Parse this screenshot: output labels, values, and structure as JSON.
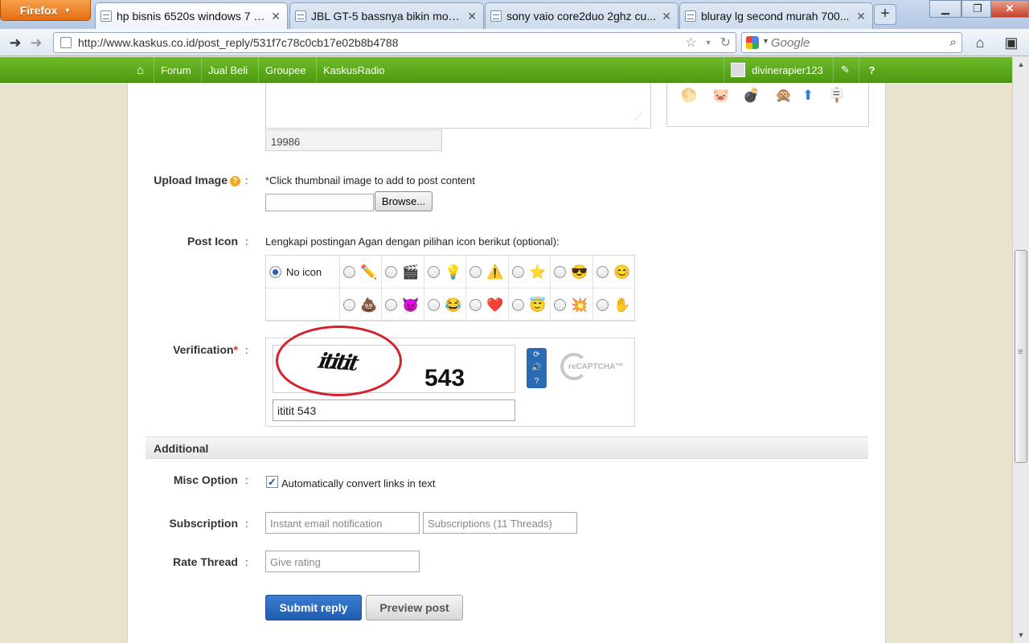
{
  "browser": {
    "menu_label": "Firefox",
    "tabs": [
      {
        "title": "hp bisnis 6520s windows 7 c...",
        "active": true
      },
      {
        "title": "JBL GT-5 bassnya bikin mob...",
        "active": false
      },
      {
        "title": "sony vaio core2duo 2ghz cu...",
        "active": false
      },
      {
        "title": "bluray lg second murah 700...",
        "active": false
      }
    ],
    "new_tab": "+",
    "url": "http://www.kaskus.co.id/post_reply/531f7c78c0cb17e02b8b4788",
    "search_placeholder": "Google"
  },
  "kaskus_nav": {
    "items": [
      "Forum",
      "Jual Beli",
      "Groupee",
      "KaskusRadio"
    ],
    "username": "divinerapier123"
  },
  "form": {
    "char_count": "19986",
    "upload_image": {
      "label": "Upload Image",
      "hint": "*Click thumbnail image to add to post content",
      "browse_label": "Browse..."
    },
    "post_icon": {
      "label": "Post Icon",
      "hint": "Lengkapi postingan Agan dengan pilihan icon berikut (optional):",
      "no_icon_label": "No icon",
      "row1": [
        "✏️",
        "🎬",
        "💡",
        "⚠️",
        "⭐",
        "😎",
        "😊"
      ],
      "row2": [
        "💩",
        "😈",
        "😂",
        "❤️",
        "😇",
        "💥",
        "✋"
      ]
    },
    "verification": {
      "label": "Verification",
      "required_mark": "*",
      "captcha_word1": "ititit",
      "captcha_word2": "543",
      "recaptcha_text": "reCAPTCHA™",
      "input_value": "ititit 543"
    },
    "additional": {
      "heading": "Additional",
      "misc_label": "Misc Option",
      "misc_checkbox_label": "Automatically convert links in text",
      "misc_checked": true,
      "subscription_label": "Subscription",
      "subscription_field1": "Instant email notification",
      "subscription_field2": "Subscriptions (11 Threads)",
      "rate_label": "Rate Thread",
      "rate_field": "Give rating"
    },
    "submit_label": "Submit reply",
    "preview_label": "Preview post"
  }
}
